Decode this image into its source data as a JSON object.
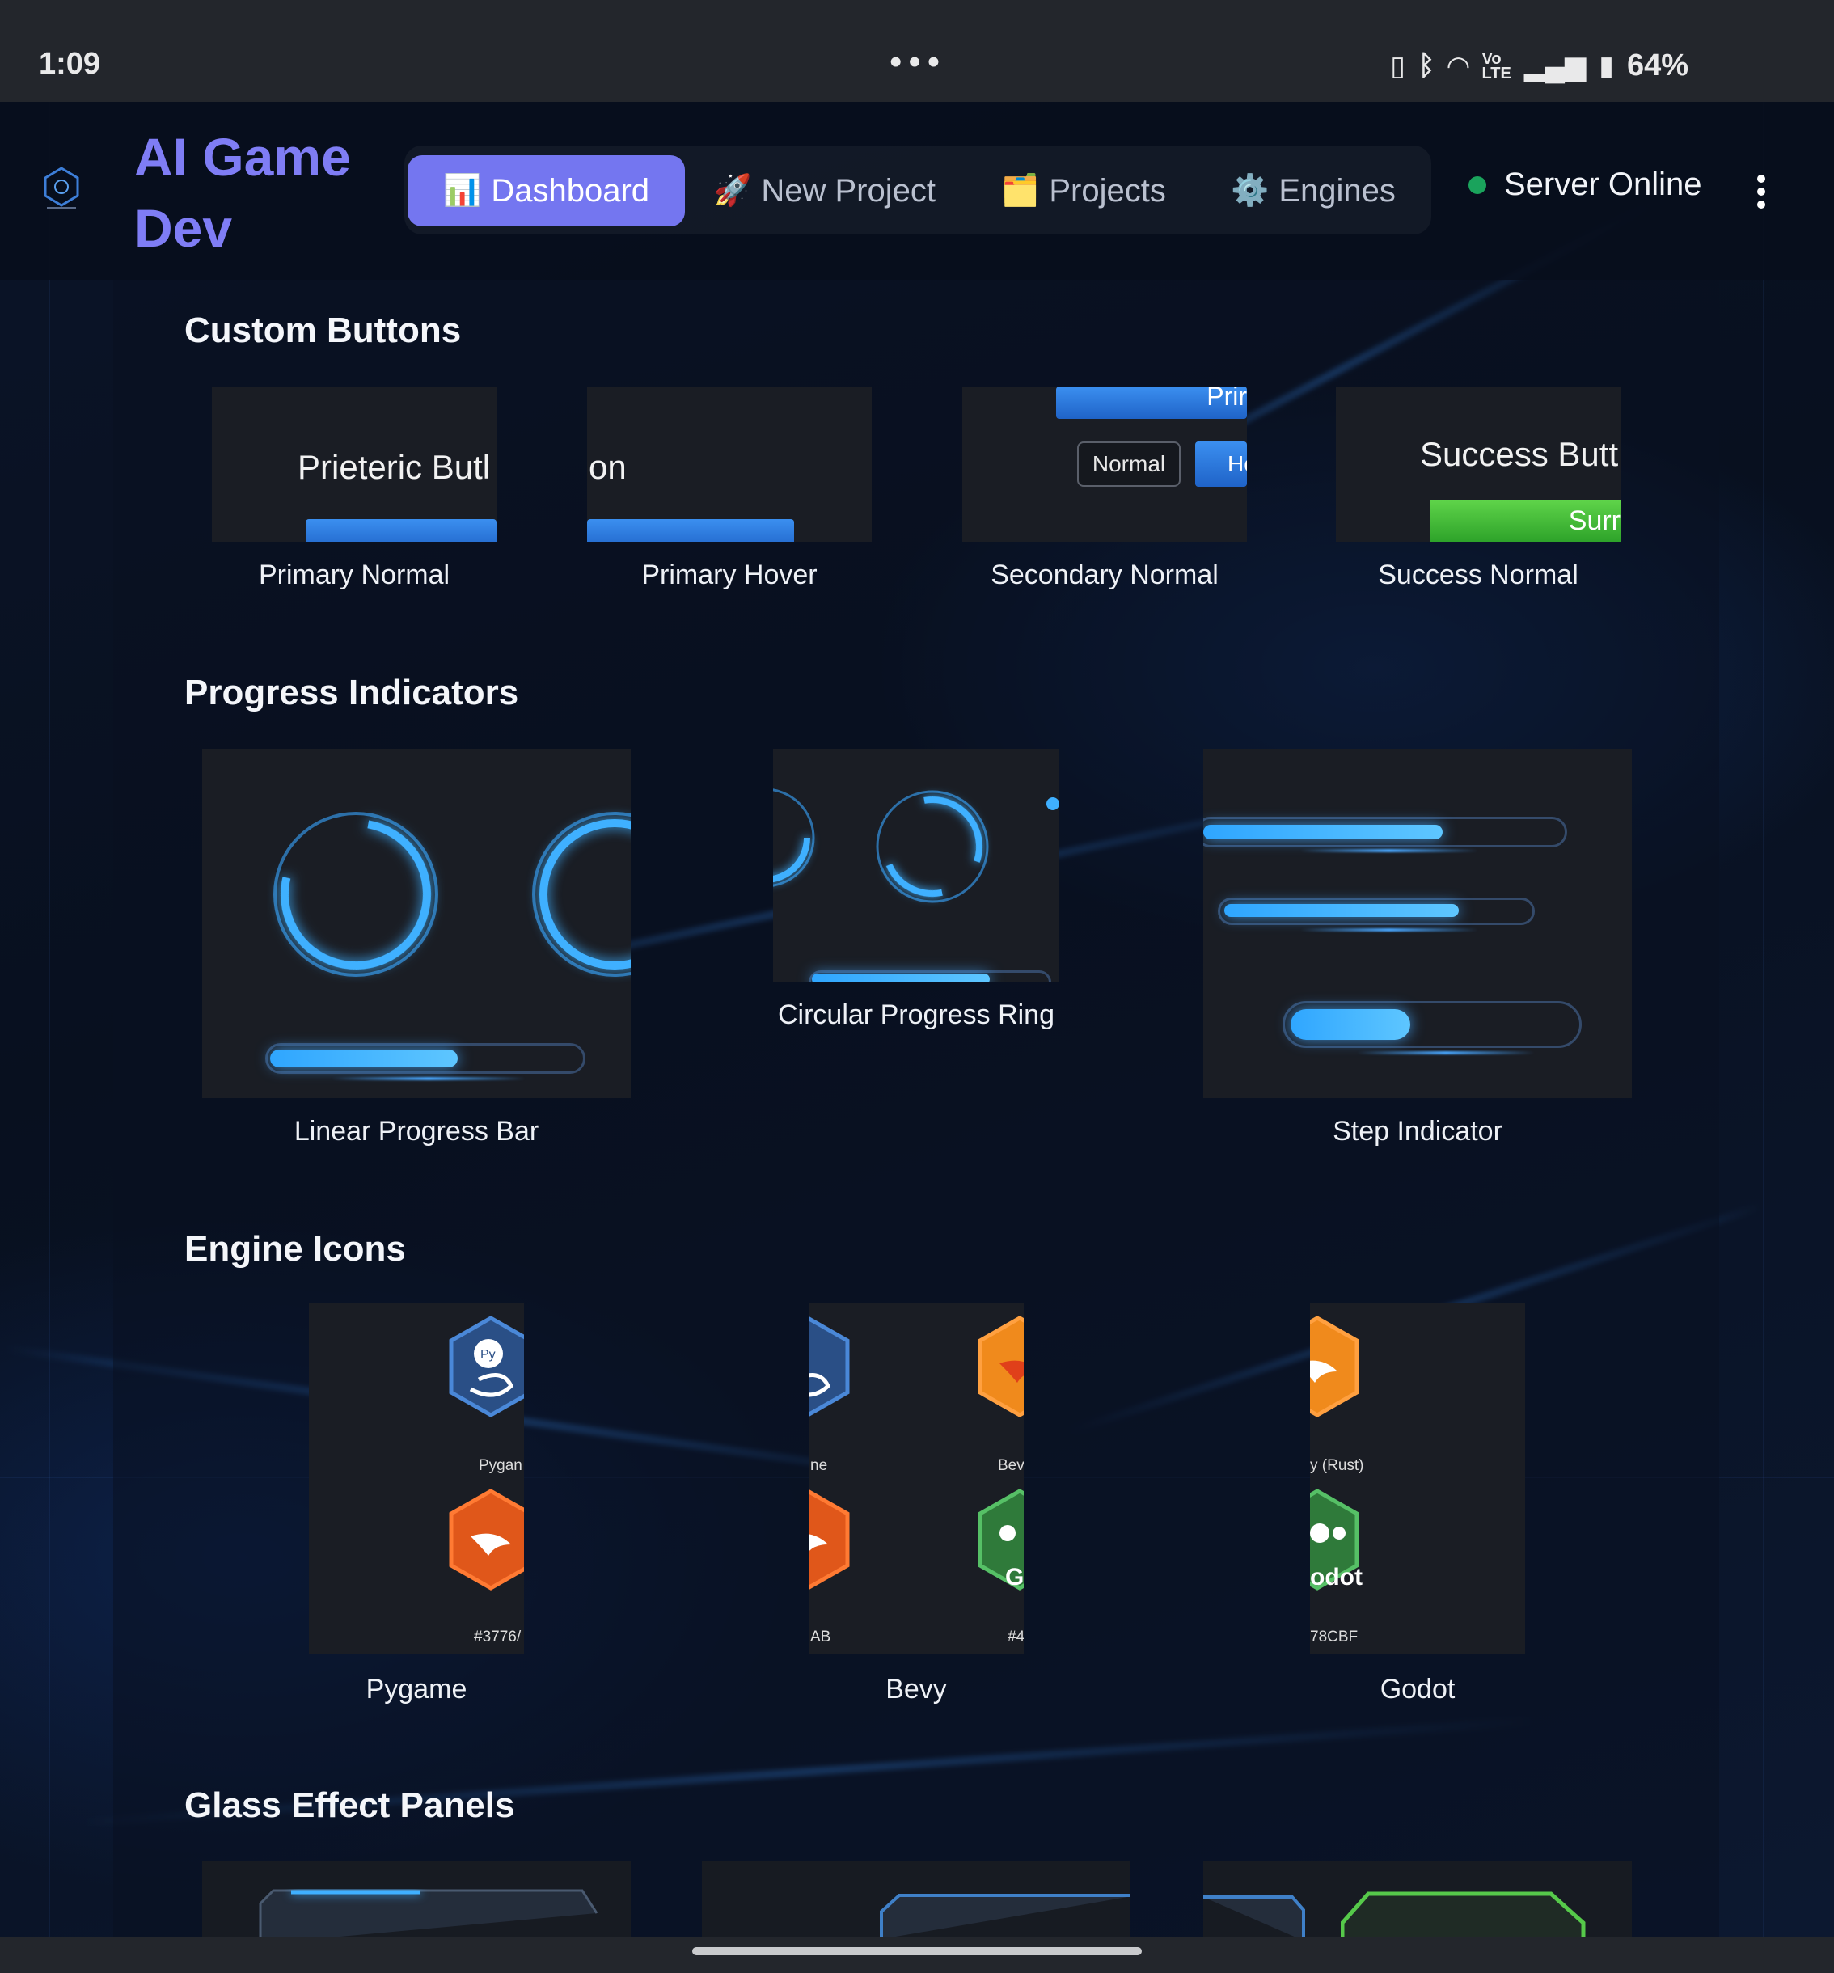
{
  "status_bar": {
    "time": "1:09",
    "dots": "•••",
    "battery": "64%",
    "icons": [
      "vibrate-icon",
      "bluetooth-icon",
      "wifi-icon",
      "volte-icon",
      "signal-icon",
      "battery-icon"
    ]
  },
  "header": {
    "app_title": "AI Game Dev",
    "tabs": [
      {
        "label": "Dashboard",
        "icon": "📊",
        "active": true
      },
      {
        "label": "New Project",
        "icon": "🚀",
        "active": false
      },
      {
        "label": "Projects",
        "icon": "🗂️",
        "active": false
      },
      {
        "label": "Engines",
        "icon": "⚙️",
        "active": false
      }
    ],
    "server_status": "Server Online",
    "server_status_color": "#1aa35c",
    "accent": "#7476f0"
  },
  "sections": {
    "buttons": {
      "title": "Custom Buttons",
      "items": [
        {
          "caption": "Primary Normal",
          "thumb_text": "Prieteric Butl"
        },
        {
          "caption": "Primary Hover",
          "thumb_text": "on"
        },
        {
          "caption": "Secondary Normal",
          "thumb_text": "Normal",
          "thumb_text_2": "Ho",
          "thumb_text_3": "Prir"
        },
        {
          "caption": "Success Normal",
          "thumb_text": "Success Butt",
          "thumb_text_2": "Surr"
        }
      ]
    },
    "progress": {
      "title": "Progress Indicators",
      "items": [
        {
          "caption": "Linear Progress Bar",
          "value": 0.6
        },
        {
          "caption": "Circular Progress Ring"
        },
        {
          "caption": "Step Indicator"
        }
      ]
    },
    "engines": {
      "title": "Engine Icons",
      "items": [
        {
          "caption": "Pygame",
          "thumb_label_1": "Pygan",
          "thumb_label_2": "#3776/"
        },
        {
          "caption": "Bevy",
          "thumb_label_1": "ne",
          "thumb_label_2": "Bev",
          "thumb_label_3": "AB",
          "thumb_label_4": "#4",
          "thumb_label_5": "G"
        },
        {
          "caption": "Godot",
          "thumb_label_1": "y (Rust)",
          "thumb_label_2": "odot",
          "thumb_label_3": "78CBF"
        }
      ],
      "colors": {
        "pygame": "#3776AB",
        "bevy": "#e8621c",
        "godot": "#478CBF"
      }
    },
    "glass": {
      "title": "Glass Effect Panels"
    }
  }
}
